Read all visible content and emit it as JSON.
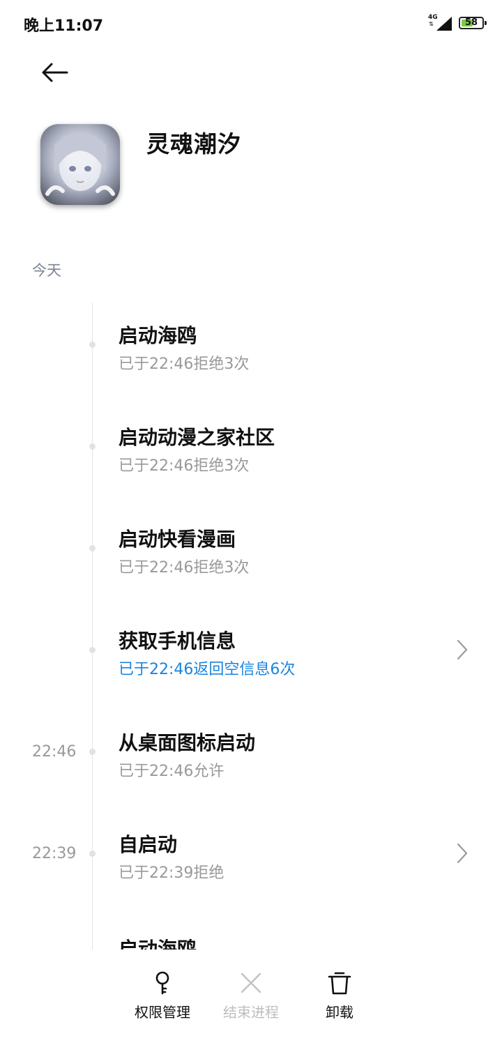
{
  "status_bar": {
    "time": "晚上11:07",
    "network": "4G",
    "network_arrows": "⇅",
    "battery_level": "58",
    "battery_fraction": 0.58
  },
  "header": {
    "back_icon": "arrow-left-icon",
    "app_name": "灵魂潮汐"
  },
  "section": {
    "today_label": "今天"
  },
  "timeline": [
    {
      "time": "",
      "title": "启动海鸥",
      "subtitle": "已于22:46拒绝3次",
      "highlight": false,
      "chevron": false
    },
    {
      "time": "",
      "title": "启动动漫之家社区",
      "subtitle": "已于22:46拒绝3次",
      "highlight": false,
      "chevron": false
    },
    {
      "time": "",
      "title": "启动快看漫画",
      "subtitle": "已于22:46拒绝3次",
      "highlight": false,
      "chevron": false
    },
    {
      "time": "",
      "title": "获取手机信息",
      "subtitle": "已于22:46返回空信息6次",
      "highlight": true,
      "chevron": true
    },
    {
      "time": "22:46",
      "title": "从桌面图标启动",
      "subtitle": "已于22:46允许",
      "highlight": false,
      "chevron": false
    },
    {
      "time": "22:39",
      "title": "自启动",
      "subtitle": "已于22:39拒绝",
      "highlight": false,
      "chevron": true
    }
  ],
  "partial_entry": {
    "title": "启动海鸥"
  },
  "bottom_actions": {
    "permissions_label": "权限管理",
    "permissions_icon": "key-icon",
    "end_process_label": "结束进程",
    "end_process_icon": "close-icon",
    "end_process_enabled": false,
    "uninstall_label": "卸载",
    "uninstall_icon": "trash-icon"
  },
  "colors": {
    "highlight_blue": "#1a84df",
    "secondary_gray": "#999999",
    "section_gray": "#7d8394",
    "battery_green": "#7ac943"
  }
}
